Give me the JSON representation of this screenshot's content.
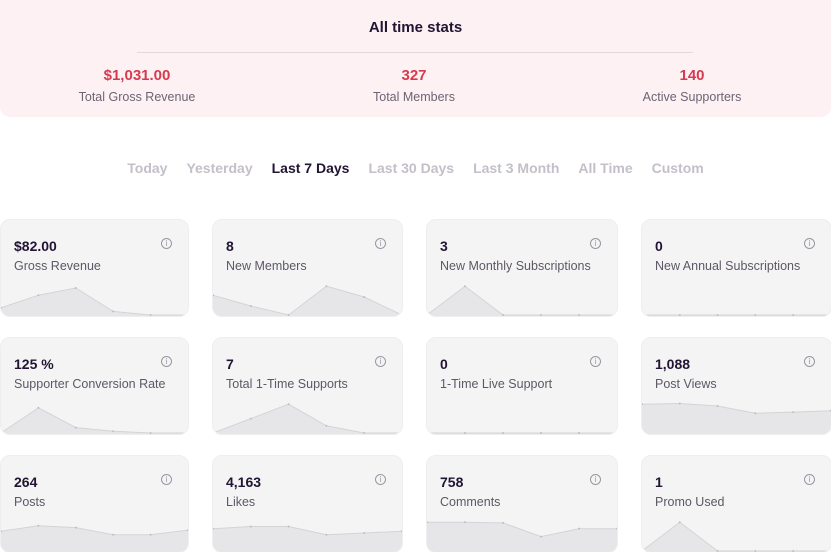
{
  "all_time": {
    "title": "All time stats",
    "stats": [
      {
        "value": "$1,031.00",
        "label": "Total Gross Revenue"
      },
      {
        "value": "327",
        "label": "Total Members"
      },
      {
        "value": "140",
        "label": "Active Supporters"
      }
    ]
  },
  "tabs": [
    "Today",
    "Yesterday",
    "Last 7 Days",
    "Last 30 Days",
    "Last 3 Month",
    "All Time",
    "Custom"
  ],
  "active_tab": "Last 7 Days",
  "info_icon": "info-circle-icon",
  "colors": {
    "accent": "#d73a4f",
    "sparkline_fill": "#e6e6e8",
    "sparkline_line": "#d4d4d7"
  },
  "cards": [
    {
      "value": "$82.00",
      "label": "Gross Revenue",
      "trend": [
        0.2,
        0.55,
        0.75,
        0.1,
        0.0,
        0.0
      ]
    },
    {
      "value": "8",
      "label": "New Members",
      "trend": [
        0.55,
        0.25,
        0.0,
        0.8,
        0.5,
        0.0
      ]
    },
    {
      "value": "3",
      "label": "New Monthly Subscriptions",
      "trend": [
        0.0,
        0.8,
        0.0,
        0.0,
        0.0,
        0.0
      ]
    },
    {
      "value": "0",
      "label": "New Annual Subscriptions",
      "trend": [
        0.0,
        0.0,
        0.0,
        0.0,
        0.0,
        0.0
      ]
    },
    {
      "value": "125 %",
      "label": "Supporter Conversion Rate",
      "trend": [
        0.0,
        0.7,
        0.15,
        0.05,
        0.0,
        0.0
      ]
    },
    {
      "value": "7",
      "label": "Total 1-Time Supports",
      "trend": [
        0.0,
        0.4,
        0.8,
        0.2,
        0.0,
        0.0
      ]
    },
    {
      "value": "0",
      "label": "1-Time Live Support",
      "trend": [
        0.0,
        0.0,
        0.0,
        0.0,
        0.0,
        0.0
      ]
    },
    {
      "value": "1,088",
      "label": "Post Views",
      "trend": [
        0.8,
        0.82,
        0.75,
        0.55,
        0.58,
        0.62
      ]
    },
    {
      "value": "264",
      "label": "Posts",
      "trend": [
        0.55,
        0.7,
        0.65,
        0.45,
        0.45,
        0.58
      ]
    },
    {
      "value": "4,163",
      "label": "Likes",
      "trend": [
        0.62,
        0.68,
        0.68,
        0.45,
        0.5,
        0.55
      ]
    },
    {
      "value": "758",
      "label": "Comments",
      "trend": [
        0.8,
        0.8,
        0.78,
        0.4,
        0.62,
        0.62
      ]
    },
    {
      "value": "1",
      "label": "Promo Used",
      "trend": [
        0.0,
        0.8,
        0.0,
        0.0,
        0.0,
        0.0
      ]
    }
  ]
}
